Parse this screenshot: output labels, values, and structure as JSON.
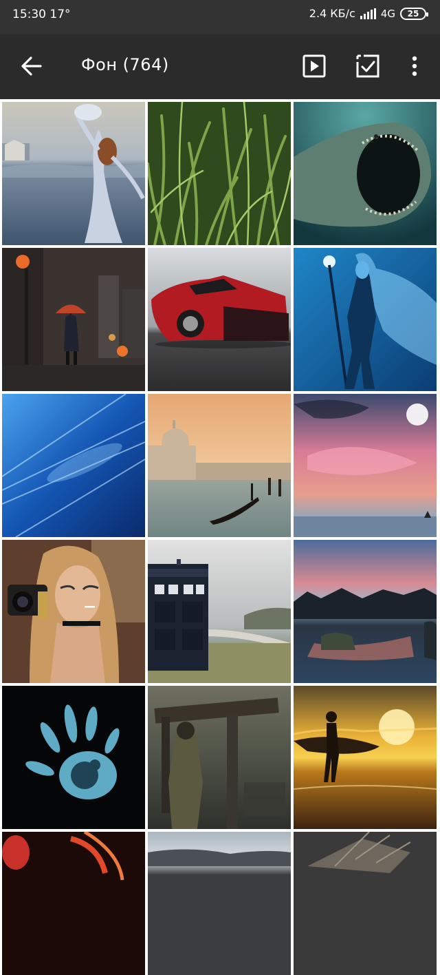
{
  "status_bar": {
    "time": "15:30",
    "temperature": "17°",
    "speed": "2.4 КБ/с",
    "network": "4G",
    "battery": "25"
  },
  "app_bar": {
    "title": "Фон (764)",
    "icons": [
      "back-arrow-icon",
      "slideshow-icon",
      "select-icon",
      "more-vert-icon"
    ]
  },
  "gallery": {
    "items": [
      {
        "subject": "woman-sea"
      },
      {
        "subject": "grass"
      },
      {
        "subject": "whale"
      },
      {
        "subject": "girl-umbrella"
      },
      {
        "subject": "red-car"
      },
      {
        "subject": "ice-warrior"
      },
      {
        "subject": "blue-abstract"
      },
      {
        "subject": "venice"
      },
      {
        "subject": "pink-sky"
      },
      {
        "subject": "woman-camera"
      },
      {
        "subject": "police-box"
      },
      {
        "subject": "rocky-shore"
      },
      {
        "subject": "glowing-hand"
      },
      {
        "subject": "stalker"
      },
      {
        "subject": "surfer-sunset"
      },
      {
        "subject": "fire-woman"
      },
      {
        "subject": "grey-landscape"
      },
      {
        "subject": "wreck"
      }
    ]
  },
  "colors": {
    "status_bar": "#333333",
    "app_bar": "#2b2b2b",
    "foreground": "#ffffff"
  }
}
